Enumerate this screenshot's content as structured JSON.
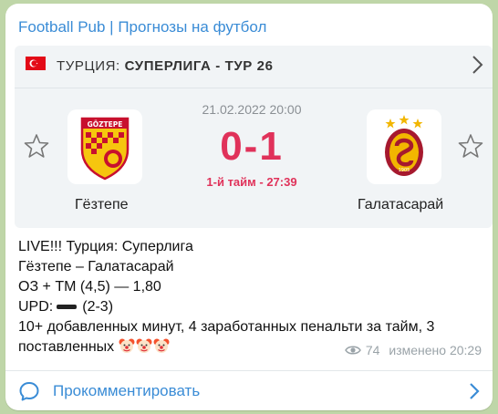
{
  "channel": {
    "title": "Football Pub | Прогнозы на футбол"
  },
  "match_card": {
    "league_country": "ТУРЦИЯ:",
    "league_name": "СУПЕРЛИГА - ТУР 26",
    "datetime": "21.02.2022 20:00",
    "score": "0-1",
    "period": "1-й тайм - 27:39",
    "home_team": "Гёзтепе",
    "away_team": "Галатасарай",
    "home_logo_text": "GÖZTEPE",
    "away_logo_text": "1905",
    "flag_icon": "turkey-flag-icon",
    "score_color": "#e0325a"
  },
  "message": {
    "lines": [
      "LIVE!!! Турция: Суперлига",
      "Гёзтепе – Галатасарай",
      "ОЗ + ТМ (4,5) — 1,80"
    ],
    "upd_label": "UPD:",
    "upd_value": "(2-3)",
    "body_line1": "10+ добавленных минут, 4 заработанных пенальти за тайм, 3",
    "body_line2": "поставленных",
    "emoji_icon": "clown-face-icon",
    "emoji_count": 3
  },
  "meta": {
    "views": "74",
    "edited": "изменено 20:29"
  },
  "comments": {
    "label": "Прокомментировать"
  },
  "colors": {
    "accent": "#3a8cd6",
    "background": "#bfd6a8"
  }
}
